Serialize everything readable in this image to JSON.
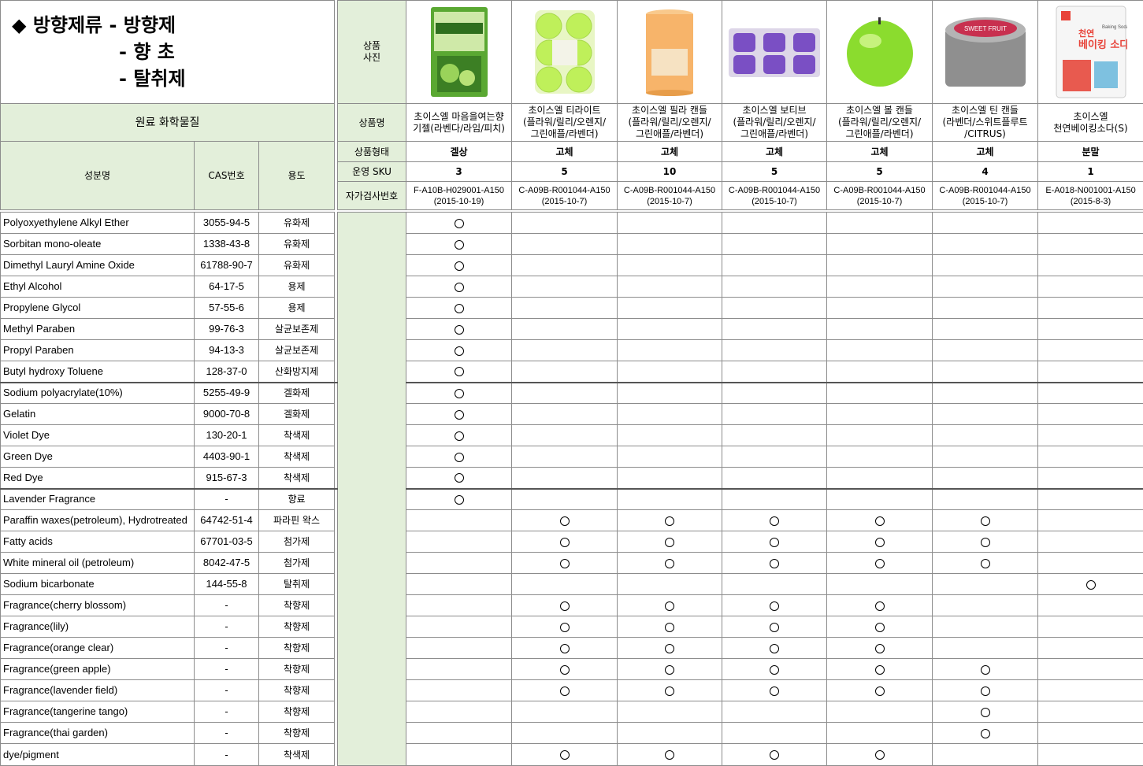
{
  "title": {
    "line1": "◆ 방향제류 - 방향제",
    "line2": "- 향 초",
    "line3": "- 탈취제"
  },
  "labels": {
    "photo": "상품\n사진",
    "name": "상품명",
    "form": "상품형태",
    "sku": "운영 SKU",
    "inspect": "자가검사번호",
    "raw_chem": "원료 화학물질",
    "ingredient": "성분명",
    "cas": "CAS번호",
    "use": "용도"
  },
  "products": [
    {
      "name": "초이스엘 마음을여는향\n기젤(라벤다/라임/피치)",
      "form": "겔상",
      "sku": "3",
      "code": "F-A10B-H029001-A150",
      "date": "(2015-10-19)",
      "image": "gel-pouch-icon",
      "color": "#5aa832"
    },
    {
      "name": "초이스엘 티라이트\n(플라워/릴리/오렌지/\n그린애플/라벤더)",
      "form": "고체",
      "sku": "5",
      "code": "C-A09B-R001044-A150",
      "date": "(2015-10-7)",
      "image": "tealight-pack-icon",
      "color": "#bff05a"
    },
    {
      "name": "초이스엘 필라 캔들\n(플라워/릴리/오렌지/\n그린애플/라벤더)",
      "form": "고체",
      "sku": "10",
      "code": "C-A09B-R001044-A150",
      "date": "(2015-10-7)",
      "image": "pillar-candle-icon",
      "color": "#f7b46a"
    },
    {
      "name": "초이스엘 보티브\n(플라워/릴리/오렌지/\n그린애플/라벤더)",
      "form": "고체",
      "sku": "5",
      "code": "C-A09B-R001044-A150",
      "date": "(2015-10-7)",
      "image": "votive-pack-icon",
      "color": "#7a4fc4"
    },
    {
      "name": "초이스엘 볼 캔들\n(플라워/릴리/오렌지/\n그린애플/라벤더)",
      "form": "고체",
      "sku": "5",
      "code": "C-A09B-R001044-A150",
      "date": "(2015-10-7)",
      "image": "ball-candle-icon",
      "color": "#8bdc2e"
    },
    {
      "name": "초이스엘 틴 캔들\n(라벤더/스위트플루트\n/CITRUS)",
      "form": "고체",
      "sku": "4",
      "code": "C-A09B-R001044-A150",
      "date": "(2015-10-7)",
      "image": "tin-candle-icon",
      "color": "#c8304f",
      "image_text": "SWEET FRUIT"
    },
    {
      "name": "초이스엘\n천연베이킹소다(S)",
      "form": "분말",
      "sku": "1",
      "code": "E-A018-N001001-A150",
      "date": "(2015-8-3)",
      "image": "baking-soda-pouch-icon",
      "color": "#e8443a",
      "image_text": "천연\n베이킹 소다",
      "image_small_text": "Baking Soda"
    }
  ],
  "ingredients": [
    {
      "name": "Polyoxyethylene Alkyl Ether",
      "cas": "3055-94-5",
      "use": "유화제",
      "marks": [
        true,
        false,
        false,
        false,
        false,
        false,
        false
      ]
    },
    {
      "name": "Sorbitan mono-oleate",
      "cas": "1338-43-8",
      "use": "유화제",
      "marks": [
        true,
        false,
        false,
        false,
        false,
        false,
        false
      ]
    },
    {
      "name": "Dimethyl Lauryl  Amine Oxide",
      "cas": "61788-90-7",
      "use": "유화제",
      "marks": [
        true,
        false,
        false,
        false,
        false,
        false,
        false
      ]
    },
    {
      "name": "Ethyl Alcohol",
      "cas": "64-17-5",
      "use": "용제",
      "marks": [
        true,
        false,
        false,
        false,
        false,
        false,
        false
      ]
    },
    {
      "name": "Propylene Glycol",
      "cas": "57-55-6",
      "use": "용제",
      "marks": [
        true,
        false,
        false,
        false,
        false,
        false,
        false
      ]
    },
    {
      "name": "Methyl Paraben",
      "cas": "99-76-3",
      "use": "살균보존제",
      "marks": [
        true,
        false,
        false,
        false,
        false,
        false,
        false
      ]
    },
    {
      "name": "Propyl Paraben",
      "cas": "94-13-3",
      "use": "살균보존제",
      "marks": [
        true,
        false,
        false,
        false,
        false,
        false,
        false
      ]
    },
    {
      "name": "Butyl hydroxy Toluene",
      "cas": "128-37-0",
      "use": "산화방지제",
      "marks": [
        true,
        false,
        false,
        false,
        false,
        false,
        false
      ]
    },
    {
      "name": "Sodium polyacrylate(10%)",
      "cas": "5255-49-9",
      "use": "겔화제",
      "marks": [
        true,
        false,
        false,
        false,
        false,
        false,
        false
      ]
    },
    {
      "name": "Gelatin",
      "cas": "9000-70-8",
      "use": "겔화제",
      "marks": [
        true,
        false,
        false,
        false,
        false,
        false,
        false
      ]
    },
    {
      "name": "Violet Dye",
      "cas": "130-20-1",
      "use": "착색제",
      "marks": [
        true,
        false,
        false,
        false,
        false,
        false,
        false
      ]
    },
    {
      "name": "Green Dye",
      "cas": "4403-90-1",
      "use": "착색제",
      "marks": [
        true,
        false,
        false,
        false,
        false,
        false,
        false
      ]
    },
    {
      "name": "Red Dye",
      "cas": "915-67-3",
      "use": "착색제",
      "marks": [
        true,
        false,
        false,
        false,
        false,
        false,
        false
      ]
    },
    {
      "name": "Lavender Fragrance",
      "cas": "-",
      "use": "향료",
      "marks": [
        true,
        false,
        false,
        false,
        false,
        false,
        false
      ]
    },
    {
      "name": "Paraffin waxes(petroleum), Hydrotreated",
      "cas": "64742-51-4",
      "use": "파라핀 왁스",
      "marks": [
        false,
        true,
        true,
        true,
        true,
        true,
        false
      ]
    },
    {
      "name": "Fatty acids",
      "cas": "67701-03-5",
      "use": "첨가제",
      "marks": [
        false,
        true,
        true,
        true,
        true,
        true,
        false
      ]
    },
    {
      "name": "White mineral oil (petroleum)",
      "cas": "8042-47-5",
      "use": "첨가제",
      "marks": [
        false,
        true,
        true,
        true,
        true,
        true,
        false
      ]
    },
    {
      "name": "Sodium bicarbonate",
      "cas": "144-55-8",
      "use": "탈취제",
      "marks": [
        false,
        false,
        false,
        false,
        false,
        false,
        true
      ]
    },
    {
      "name": "Fragrance(cherry blossom)",
      "cas": "-",
      "use": "착향제",
      "marks": [
        false,
        true,
        true,
        true,
        true,
        false,
        false
      ]
    },
    {
      "name": "Fragrance(lily)",
      "cas": "-",
      "use": "착향제",
      "marks": [
        false,
        true,
        true,
        true,
        true,
        false,
        false
      ]
    },
    {
      "name": "Fragrance(orange clear)",
      "cas": "-",
      "use": "착향제",
      "marks": [
        false,
        true,
        true,
        true,
        true,
        false,
        false
      ]
    },
    {
      "name": "Fragrance(green apple)",
      "cas": "-",
      "use": "착향제",
      "marks": [
        false,
        true,
        true,
        true,
        true,
        true,
        false
      ]
    },
    {
      "name": "Fragrance(lavender field)",
      "cas": "-",
      "use": "착향제",
      "marks": [
        false,
        true,
        true,
        true,
        true,
        true,
        false
      ]
    },
    {
      "name": "Fragrance(tangerine tango)",
      "cas": "-",
      "use": "착향제",
      "marks": [
        false,
        false,
        false,
        false,
        false,
        true,
        false
      ]
    },
    {
      "name": "Fragrance(thai garden)",
      "cas": "-",
      "use": "착향제",
      "marks": [
        false,
        false,
        false,
        false,
        false,
        true,
        false
      ]
    },
    {
      "name": "dye/pigment",
      "cas": "-",
      "use": "착색제",
      "marks": [
        false,
        true,
        true,
        true,
        true,
        false,
        false
      ]
    }
  ]
}
